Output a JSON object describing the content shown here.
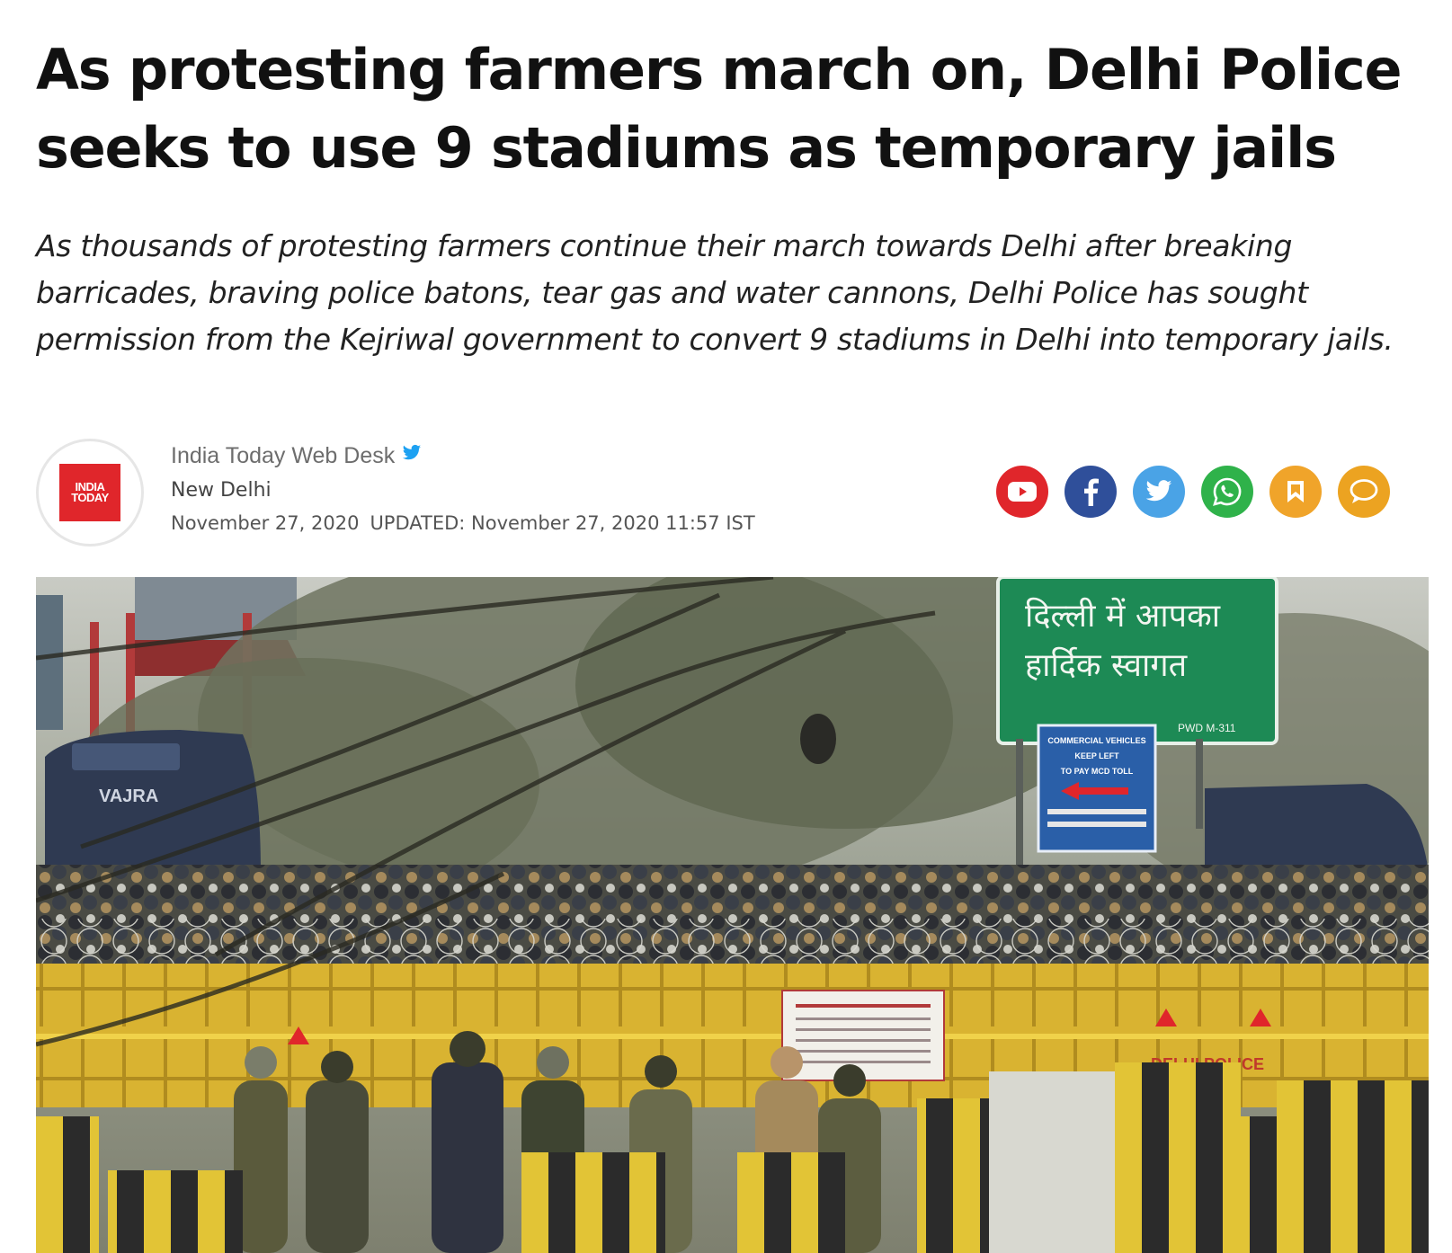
{
  "article": {
    "headline": "As protesting farmers march on, Delhi Police seeks to use 9 stadiums as temporary jails",
    "summary": "As thousands of protesting farmers continue their march towards Delhi after breaking barricades, braving police batons, tear gas and water cannons, Delhi Police has sought permission from the Kejriwal government to convert 9 stadiums in Delhi into temporary jails."
  },
  "byline": {
    "logo_line1": "INDIA",
    "logo_line2": "TODAY",
    "author": "India Today Web Desk",
    "location": "New Delhi",
    "published": "November 27, 2020",
    "updated": "UPDATED: November 27, 2020 11:57 IST"
  },
  "share": {
    "buttons": [
      {
        "icon": "youtube-icon",
        "color": "#e0262b"
      },
      {
        "icon": "facebook-icon",
        "color": "#2f4f9a"
      },
      {
        "icon": "twitter-icon",
        "color": "#4aa3e6"
      },
      {
        "icon": "whatsapp-icon",
        "color": "#2fb24a"
      },
      {
        "icon": "bookmark-icon",
        "color": "#f0a42a"
      },
      {
        "icon": "comment-icon",
        "color": "#eca321"
      }
    ]
  },
  "photo": {
    "sign_top_1": "दिल्ली में आपका",
    "sign_top_2": "हार्दिक स्वागत",
    "sign_pwd": "PWD M-311",
    "sign_blue_1": "COMMERCIAL VEHICLES",
    "sign_blue_2": "KEEP LEFT",
    "sign_blue_3": "TO PAY MCD TOLL",
    "vehicle_label": "VAJRA",
    "barrier_text": "DELHI POLICE"
  },
  "colors": {
    "brand_red": "#e0262b",
    "barricade_yellow": "#e9c23a",
    "sign_green": "#1d8a55",
    "sign_blue": "#2a5fa8"
  }
}
